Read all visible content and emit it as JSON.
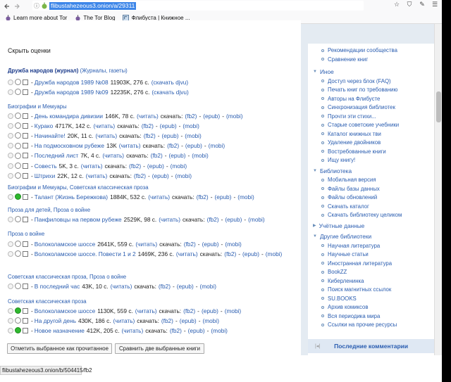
{
  "browser": {
    "url": "flibustahezeous3.onion/a/29311",
    "bookmarks": [
      {
        "label": "Learn more about Tor",
        "icon": "tor-onion-icon"
      },
      {
        "label": "The Tor Blog",
        "icon": "tor-blog-icon"
      },
      {
        "label": "Флибуста | Книжное ...",
        "icon": "flibusta-icon"
      }
    ],
    "status_url": "flibustahezeous3.onion/b/504415/fb2"
  },
  "page": {
    "hide_ratings": "Скрыть оценки",
    "labels": {
      "download": "скачать:",
      "read": "(читать)",
      "fb2": "(fb2)",
      "epub": "(epub)",
      "mobi": "(mobi)",
      "djvu": "(скачать djvu)"
    },
    "sections": [
      {
        "title": "Дружба народов (журнал)",
        "genres": "(Журналы, газеты)",
        "bold": true,
        "rows": [
          {
            "title": "Дружба народов 1989 №08",
            "info": "11903K, 276 с.",
            "kind": "djvu",
            "radio": "none",
            "star": "none"
          },
          {
            "title": "Дружба народов 1989 №09",
            "info": "12235K, 276 с.",
            "kind": "djvu",
            "radio": "none",
            "star": "none"
          }
        ]
      },
      {
        "title": "Биографии и Мемуары",
        "rows": [
          {
            "title": "День командира дивизии",
            "info": "146K, 78 с.",
            "kind": "full"
          },
          {
            "title": "Курако",
            "info": "4717K, 142 с.",
            "kind": "full"
          },
          {
            "title": "Начинайте!",
            "info": "20K, 11 с.",
            "kind": "full"
          },
          {
            "title": "На подмосковном рубеже",
            "info": "13K",
            "kind": "full"
          },
          {
            "title": "Последний лист",
            "info": "7K, 4 с.",
            "kind": "full"
          },
          {
            "title": "Совесть",
            "info": "5K, 3 с.",
            "kind": "full"
          },
          {
            "title": "Штрихи",
            "info": "22K, 12 с.",
            "kind": "full"
          }
        ]
      },
      {
        "title": "Биографии и Мемуары, Советская классическая проза",
        "rows": [
          {
            "title": "Талант (Жизнь Бережкова)",
            "info": "1884K, 532 с.",
            "kind": "full",
            "green": true
          }
        ]
      },
      {
        "title": "Проза для детей, Проза о войне",
        "rows": [
          {
            "title": "Панфиловцы на первом рубеже",
            "info": "2529K, 98 с.",
            "kind": "full"
          }
        ]
      },
      {
        "title": "Проза о войне",
        "rows": [
          {
            "title": "Волоколамское шоссе",
            "info": "2641K, 559 с.",
            "kind": "full"
          },
          {
            "title": "Волоколамское шоссе. Повести 1 и 2",
            "info": "1469K, 236 с.",
            "kind": "full"
          }
        ]
      },
      {
        "title": "Советская классическая проза, Проза о войне",
        "rows": [
          {
            "title": "В последний час",
            "info": "43K, 10 с.",
            "kind": "full"
          }
        ]
      },
      {
        "title": "Советская классическая проза",
        "rows": [
          {
            "title": "Волоколамское шоссе",
            "info": "1130K, 559 с.",
            "kind": "full",
            "green": true
          },
          {
            "title": "На другой день",
            "info": "430K, 186 с.",
            "kind": "full"
          },
          {
            "title": "Новое назначение",
            "info": "412K, 205 с.",
            "kind": "full",
            "green": true
          }
        ]
      }
    ],
    "buttons": {
      "mark_read": "Отметить выбранное как прочитанное",
      "compare": "Сравнить две выбранные книги"
    }
  },
  "sidebar": {
    "top_items": [
      "Рекомендации сообщества",
      "Сравнение книг"
    ],
    "groups": [
      {
        "title": "Иное",
        "items": [
          "Доступ через блок (FAQ)",
          "Печать книг по требованию",
          "Авторы на Флибусте",
          "Синхронизация библиотек",
          "Прочти эти стихи...",
          "Старые советские учебники",
          "Каталог книжных тви",
          "Удаление двойников",
          "Востребованные книги",
          "Ищу книгу!"
        ]
      },
      {
        "title": "Библиотека",
        "items": [
          "Мобильная версия",
          "Файлы базы данных",
          "Файлы обновлений",
          "Скачать каталог",
          "Скачать библиотеку целиком"
        ]
      },
      {
        "title": "Учётные данные",
        "items": [],
        "collapsed": true
      },
      {
        "title": "Другие библиотеки",
        "items": [
          "Научная литература",
          "Научные статьи",
          "Иностранная литература",
          "BookZZ",
          "Киберленинка",
          "Поиск магнитных ссылок",
          "SU.BOOKS",
          "Архив комиксов",
          "Вся периодика мира",
          "Ссылки на прочие ресурсы"
        ]
      }
    ],
    "latest_comments": "Последние комментарии"
  }
}
